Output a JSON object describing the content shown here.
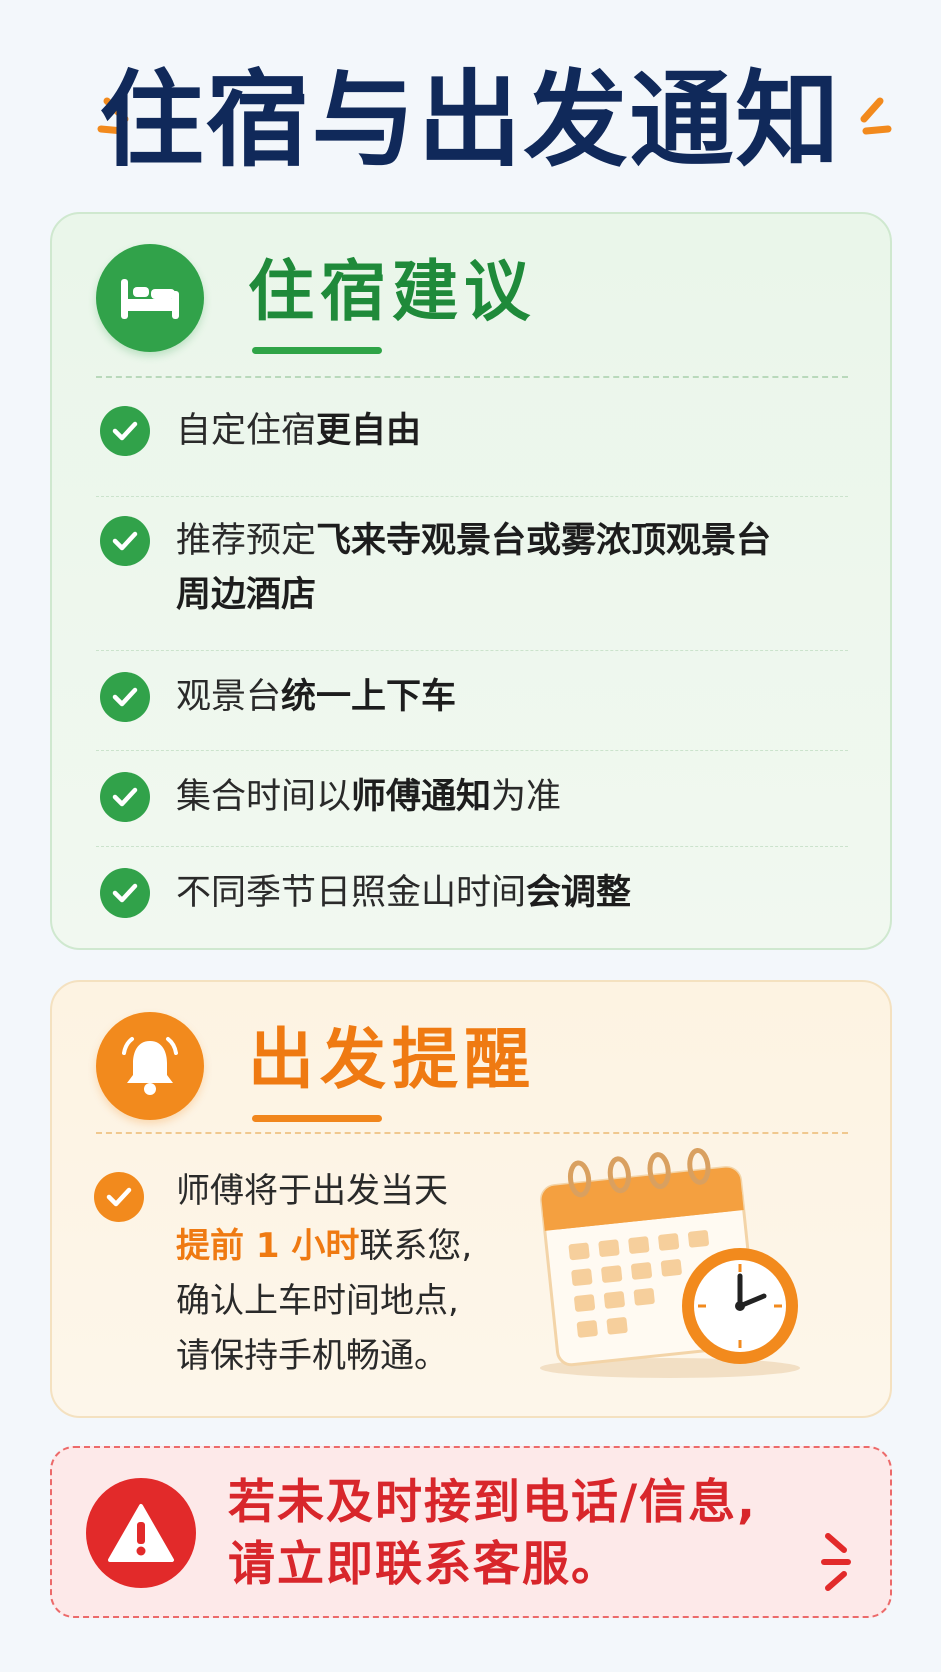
{
  "title": "住宿与出发通知",
  "colors": {
    "title": "#10295a",
    "green_accent": "#31a24a",
    "orange_accent": "#f28a1d",
    "red_accent": "#e22a2a"
  },
  "accommodation": {
    "icon": "bed-icon",
    "title": "住宿建议",
    "items": [
      {
        "text": "自定住宿",
        "bold": "更自由",
        "tail": ""
      },
      {
        "text": "推荐预定",
        "bold": "飞来寺观景台或雾浓顶观景台周边酒店",
        "tail": ""
      },
      {
        "text": "观景台",
        "bold": "统一上下车",
        "tail": ""
      },
      {
        "text": "集合时间以",
        "bold": "师傅通知",
        "tail": "为准"
      },
      {
        "text": "不同季节日照金山时间",
        "bold": "会调整",
        "tail": ""
      }
    ]
  },
  "departure": {
    "icon": "bell-icon",
    "title": "出发提醒",
    "line1": "师傅将于出发当天",
    "highlight": "提前 1 小时",
    "line2_tail": "联系您,",
    "line3": "确认上车时间地点,",
    "line4": "请保持手机畅通。",
    "illustration": "calendar-clock-icon"
  },
  "warning": {
    "icon": "warning-icon",
    "line1": "若未及时接到电话/信息,",
    "line2": "请立即联系客服。"
  }
}
